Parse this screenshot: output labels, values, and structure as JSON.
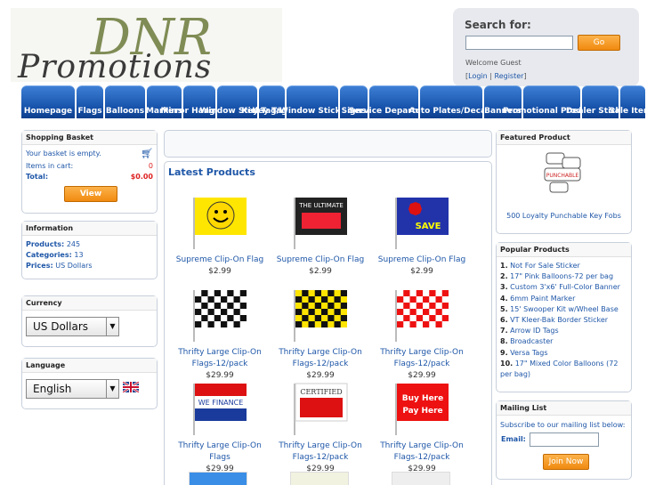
{
  "header": {
    "logo_text": "DNR Promotions"
  },
  "search": {
    "label": "Search for:",
    "go_label": "Go",
    "welcome": "Welcome Guest",
    "login": "Login",
    "register": "Register"
  },
  "nav": [
    {
      "label": "Homepage"
    },
    {
      "label": "Flags"
    },
    {
      "label": "Balloons"
    },
    {
      "label": "Markers"
    },
    {
      "label": "Mirror Hang Tags"
    },
    {
      "label": "Window Stickers"
    },
    {
      "label": "Key Tags"
    },
    {
      "label": "Key Tag/Window Sticker Combo"
    },
    {
      "label": "Signs"
    },
    {
      "label": "Service Department"
    },
    {
      "label": "Auto Plates/Decals"
    },
    {
      "label": "Banners"
    },
    {
      "label": "Promotional Products"
    },
    {
      "label": "Dealer Stickers"
    },
    {
      "label": "Sale Items"
    }
  ],
  "basket": {
    "title": "Shopping Basket",
    "empty_msg": "Your basket is empty.",
    "items_label": "Items in cart:",
    "items_value": "0",
    "total_label": "Total:",
    "total_value": "$0.00",
    "view_button": "View Basket"
  },
  "info": {
    "title": "Information",
    "products_label": "Products:",
    "products_value": "245",
    "categories_label": "Categories:",
    "categories_value": "13",
    "prices_label": "Prices:",
    "prices_value": "US Dollars"
  },
  "currency": {
    "title": "Currency",
    "selected": "US Dollars"
  },
  "language": {
    "title": "Language",
    "selected": "English"
  },
  "main": {
    "latest_title": "Latest Products"
  },
  "products": [
    {
      "name": "Supreme Clip-On Flag",
      "price": "$2.99",
      "img": "smiley"
    },
    {
      "name": "Supreme Clip-On Flag",
      "price": "$2.99",
      "img": "ultimate",
      "img_text": "THE ULTIMATE"
    },
    {
      "name": "Supreme Clip-On Flag",
      "price": "$2.99",
      "img": "stop",
      "img_text": "SAVE"
    },
    {
      "name": "Thrifty Large Clip-On Flags-12/pack",
      "price": "$29.99",
      "img": "checker-black"
    },
    {
      "name": "Thrifty Large Clip-On Flags-12/pack",
      "price": "$29.99",
      "img": "checker-yellow"
    },
    {
      "name": "Thrifty Large Clip-On Flags-12/pack",
      "price": "$29.99",
      "img": "checker-red"
    },
    {
      "name": "Thrifty Large Clip-On Flags",
      "price": "$29.99",
      "img": "finance",
      "img_text": "WE FINANCE"
    },
    {
      "name": "Thrifty Large Clip-On Flags-12/pack",
      "price": "$29.99",
      "img": "certified",
      "img_text": "CERTIFIED"
    },
    {
      "name": "Thrifty Large Clip-On Flags-12/pack",
      "price": "$29.99",
      "img": "buyhere",
      "img_text": "Buy Here Pay Here"
    }
  ],
  "featured": {
    "title": "Featured Product",
    "name": "500 Loyalty Punchable Key Fobs"
  },
  "popular": {
    "title": "Popular Products",
    "items": [
      {
        "num": "1.",
        "label": "Not For Sale Sticker"
      },
      {
        "num": "2.",
        "label": "17\" Pink Balloons-72 per bag"
      },
      {
        "num": "3.",
        "label": "Custom 3'x6' Full-Color Banner"
      },
      {
        "num": "4.",
        "label": "6mm Paint Marker"
      },
      {
        "num": "5.",
        "label": "15' Swooper Kit w/Wheel Base"
      },
      {
        "num": "6.",
        "label": "VT Kleer-Bak Border Sticker"
      },
      {
        "num": "7.",
        "label": "Arrow ID Tags"
      },
      {
        "num": "8.",
        "label": "Broadcaster"
      },
      {
        "num": "9.",
        "label": "Versa Tags"
      },
      {
        "num": "10.",
        "label": "17\" Mixed Color Balloons (72 per bag)"
      }
    ]
  },
  "mailing": {
    "title": "Mailing List",
    "text": "Subscribe to our mailing list below:",
    "email_label": "Email:",
    "join_button": "Join Now"
  },
  "colors": {
    "nav_blue": "#1550a8",
    "link_blue": "#1f57a8",
    "orange": "#f08a10"
  }
}
